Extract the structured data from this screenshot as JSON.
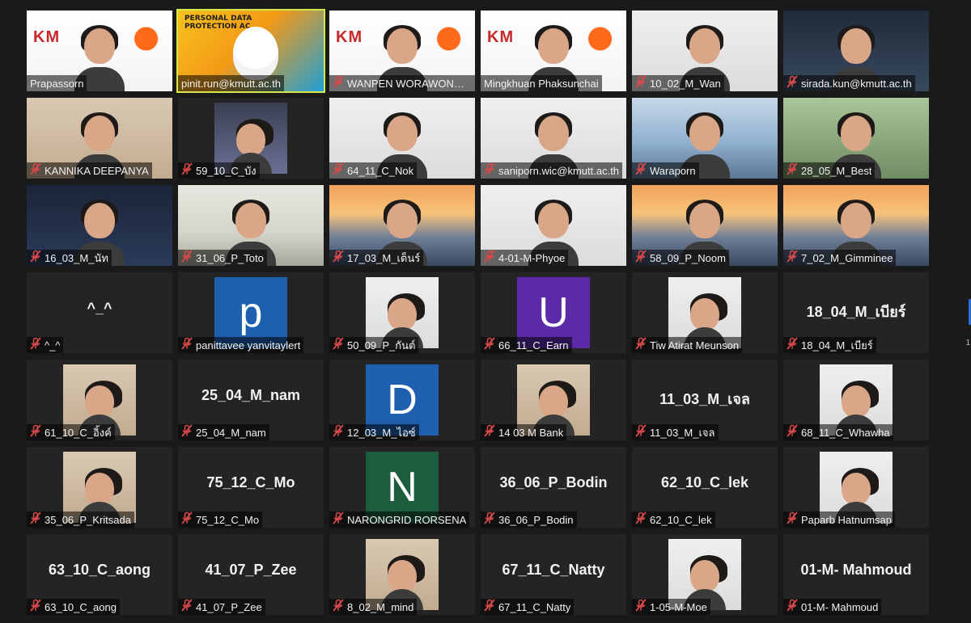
{
  "tiles": [
    {
      "name": "Prapassorn",
      "muted": false,
      "style": "slide-person",
      "bg": "#ffffff"
    },
    {
      "name": "pinit.run@kmutt.ac.th",
      "muted": false,
      "style": "poster",
      "active": true,
      "poster_title": "PERSONAL DATA PROTECTION AC"
    },
    {
      "name": "WANPEN WORAWONGPONGSA",
      "muted": true,
      "style": "slide-person"
    },
    {
      "name": "Mingkhuan Phaksunchai",
      "muted": false,
      "style": "slide-person"
    },
    {
      "name": "10_02_M_Wan",
      "muted": true,
      "style": "person",
      "scene": "white"
    },
    {
      "name": "sirada.kun@kmutt.ac.th",
      "muted": true,
      "style": "person",
      "scene": "night"
    },
    {
      "name": "KANNIKA DEEPANYA",
      "muted": true,
      "style": "person",
      "scene": "room"
    },
    {
      "name": "59_10_C_บัง",
      "muted": true,
      "style": "photo",
      "scene": "anime"
    },
    {
      "name": "64_11_C_Nok",
      "muted": true,
      "style": "person",
      "scene": "white"
    },
    {
      "name": "saniporn.wic@kmutt.ac.th",
      "muted": true,
      "style": "person",
      "scene": "white"
    },
    {
      "name": "Waraporn",
      "muted": true,
      "style": "person",
      "scene": "building"
    },
    {
      "name": "28_05_M_Best",
      "muted": true,
      "style": "person",
      "scene": "green"
    },
    {
      "name": "16_03_M_นัท",
      "muted": true,
      "style": "person",
      "scene": "cyber"
    },
    {
      "name": "31_06_P_Toto",
      "muted": true,
      "style": "person",
      "scene": "office"
    },
    {
      "name": "17_03_M_เต็นร์",
      "muted": true,
      "style": "person",
      "scene": "sunset"
    },
    {
      "name": "4-01-M-Phyoe",
      "muted": true,
      "style": "person",
      "scene": "white"
    },
    {
      "name": "58_09_P_Noom",
      "muted": true,
      "style": "person",
      "scene": "sunset"
    },
    {
      "name": "7_02_M_Gimminee",
      "muted": true,
      "style": "person",
      "scene": "sunset"
    },
    {
      "name": "^_^",
      "muted": true,
      "style": "bigname",
      "big": "^_^"
    },
    {
      "name": "panittavee yanvitaylert",
      "muted": true,
      "style": "letter",
      "letter": "p",
      "color": "#1e5fb0"
    },
    {
      "name": "50_09_P_กันต์",
      "muted": true,
      "style": "photo",
      "scene": "white"
    },
    {
      "name": "66_11_C_Earn",
      "muted": true,
      "style": "letter",
      "letter": "U",
      "color": "#5b2aa8"
    },
    {
      "name": "Tiw Atirat Meunson",
      "muted": true,
      "style": "photo",
      "scene": "white"
    },
    {
      "name": "18_04_M_เบียร์",
      "muted": true,
      "style": "bigname",
      "big": "18_04_M_เบียร์"
    },
    {
      "name": "61_10_C_อิ้งค์",
      "muted": true,
      "style": "photo",
      "scene": "room"
    },
    {
      "name": "25_04_M_nam",
      "muted": true,
      "style": "bigname",
      "big": "25_04_M_nam"
    },
    {
      "name": "12_03_M_ไอซ์",
      "muted": true,
      "style": "letter",
      "letter": "D",
      "color": "#1e5fb0"
    },
    {
      "name": "14 03 M Bank",
      "muted": true,
      "style": "photo",
      "scene": "room"
    },
    {
      "name": "11_03_M_เจล",
      "muted": true,
      "style": "bigname",
      "big": "11_03_M_เจล"
    },
    {
      "name": "68_11_C_Whawha",
      "muted": true,
      "style": "photo",
      "scene": "white"
    },
    {
      "name": "35_06_P_Kritsada",
      "muted": true,
      "style": "photo",
      "scene": "room"
    },
    {
      "name": "75_12_C_Mo",
      "muted": true,
      "style": "bigname",
      "big": "75_12_C_Mo"
    },
    {
      "name": "NARONGRID RORSENA",
      "muted": true,
      "style": "letter",
      "letter": "N",
      "color": "#1d5c3f"
    },
    {
      "name": "36_06_P_Bodin",
      "muted": true,
      "style": "bigname",
      "big": "36_06_P_Bodin"
    },
    {
      "name": "62_10_C_lek",
      "muted": true,
      "style": "bigname",
      "big": "62_10_C_lek"
    },
    {
      "name": "Paparb Hatnumsap",
      "muted": true,
      "style": "photo",
      "scene": "white"
    },
    {
      "name": "63_10_C_aong",
      "muted": true,
      "style": "bigname",
      "big": "63_10_C_aong"
    },
    {
      "name": "41_07_P_Zee",
      "muted": true,
      "style": "bigname",
      "big": "41_07_P_Zee"
    },
    {
      "name": "8_02_M_mind",
      "muted": true,
      "style": "photo",
      "scene": "room"
    },
    {
      "name": "67_11_C_Natty",
      "muted": true,
      "style": "bigname",
      "big": "67_11_C_Natty"
    },
    {
      "name": "1-05-M-Moe",
      "muted": true,
      "style": "photo",
      "scene": "white"
    },
    {
      "name": "01-M- Mahmoud",
      "muted": true,
      "style": "bigname",
      "big": "01-M- Mahmoud"
    }
  ],
  "colors": {
    "background": "#1a1a1a",
    "tile": "#242424",
    "active_outline": "#d5e74a",
    "mute_icon": "#d84a4a"
  },
  "edge_text": "1"
}
